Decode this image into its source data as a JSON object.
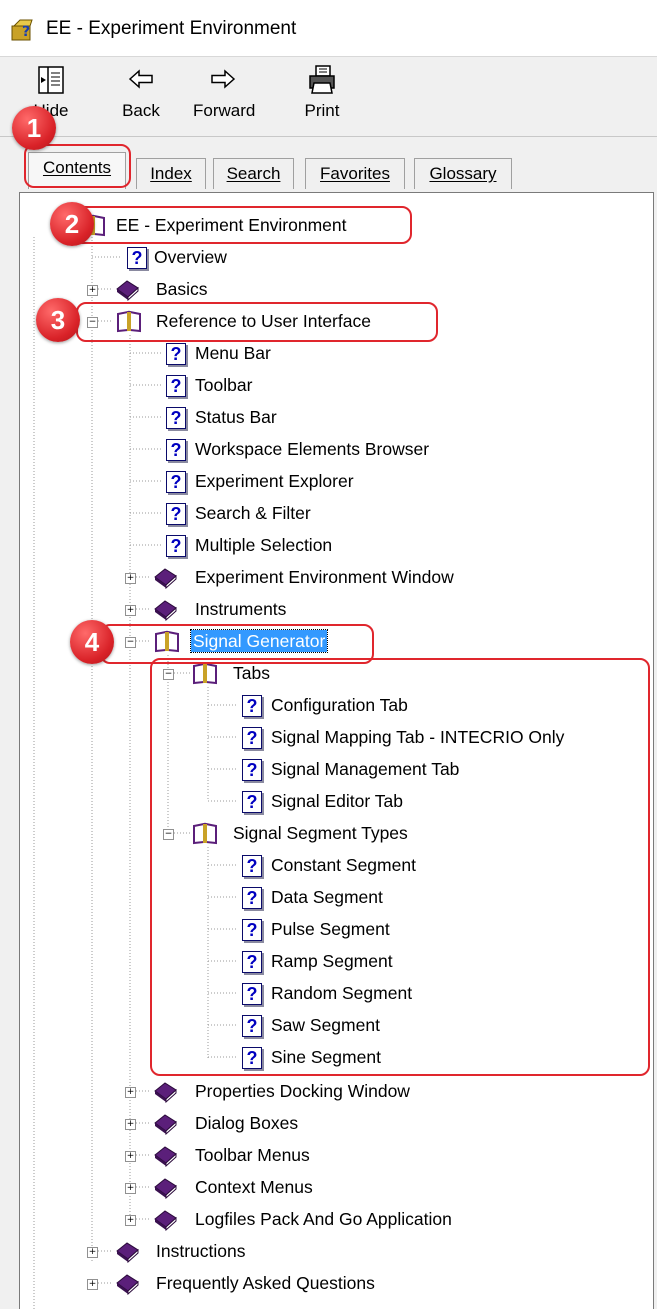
{
  "window": {
    "title": "EE - Experiment Environment"
  },
  "toolbar": {
    "hide": "Hide",
    "back": "Back",
    "forward": "Forward",
    "print": "Print"
  },
  "tabs": {
    "contents": "Contents",
    "index": "Index",
    "search": "Search",
    "favorites": "Favorites",
    "glossary": "Glossary"
  },
  "tree": {
    "root": "EE - Experiment Environment",
    "overview": "Overview",
    "basics": "Basics",
    "reference": "Reference to User Interface",
    "menu_bar": "Menu Bar",
    "toolbar": "Toolbar",
    "status_bar": "Status Bar",
    "workspace_browser": "Workspace Elements Browser",
    "experiment_explorer": "Experiment Explorer",
    "search_filter": "Search & Filter",
    "multiple_selection": "Multiple Selection",
    "ee_window": "Experiment Environment Window",
    "instruments": "Instruments",
    "signal_generator": "Signal Generator",
    "tabs_book": "Tabs",
    "configuration_tab": "Configuration Tab",
    "signal_mapping_tab": "Signal Mapping Tab - INTECRIO Only",
    "signal_management_tab": "Signal Management Tab",
    "signal_editor_tab": "Signal Editor Tab",
    "segment_types": "Signal Segment Types",
    "constant_segment": "Constant Segment",
    "data_segment": "Data Segment",
    "pulse_segment": "Pulse Segment",
    "ramp_segment": "Ramp Segment",
    "random_segment": "Random Segment",
    "saw_segment": "Saw Segment",
    "sine_segment": "Sine Segment",
    "properties_window": "Properties Docking Window",
    "dialog_boxes": "Dialog Boxes",
    "toolbar_menus": "Toolbar Menus",
    "context_menus": "Context Menus",
    "logfiles": "Logfiles Pack And Go Application",
    "instructions": "Instructions",
    "faq": "Frequently Asked Questions"
  },
  "callouts": {
    "one": "1",
    "two": "2",
    "three": "3",
    "four": "4"
  },
  "colors": {
    "callout": "#e0262d",
    "selection": "#3399ff",
    "book": "#5b1f7a"
  }
}
